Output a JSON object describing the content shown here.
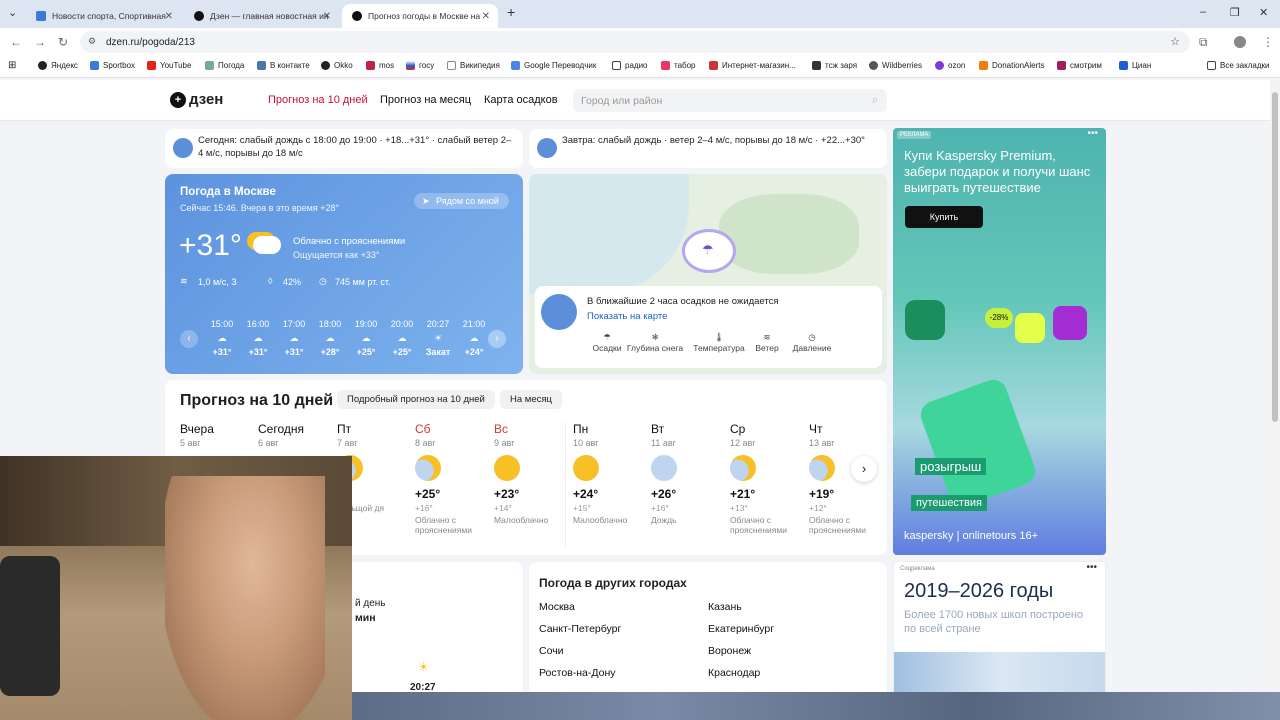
{
  "browser": {
    "tabs": [
      {
        "title": "Новости спорта, Спортивная"
      },
      {
        "title": "Дзен — главная новостная ин"
      },
      {
        "title": "Прогноз погоды в Москве на"
      }
    ],
    "new_tab": "+",
    "url": "dzen.ru/pogoda/213",
    "bookmarks": [
      "Яндекс",
      "Sportbox",
      "YouTube",
      "Погода",
      "В контакте",
      "Okko",
      "mos",
      "госу",
      "Википедия",
      "Google Переводчик",
      "радио",
      "табор",
      "Интернет-магазин...",
      "тсж заря",
      "Wildberries",
      "ozon",
      "DonationAlerts",
      "смотрим",
      "Циан"
    ],
    "all_bookmarks": "Все закладки"
  },
  "site": {
    "logo": "дзен",
    "nav": [
      "Прогноз на 10 дней",
      "Прогноз на месяц",
      "Карта осадков"
    ],
    "search_placeholder": "Город или район"
  },
  "today_banner": "Сегодня: слабый дождь с 18:00 до 19:00 · +18...+31° · слабый ветер 2–4 м/с, порывы до 18 м/с",
  "tomorrow_banner": "Завтра: слабый дождь · ветер 2–4 м/с, порывы до 18 м/с · +22...+30°",
  "current": {
    "title": "Погода в Москве",
    "subtitle": "Сейчас 15:46. Вчера в это время +28°",
    "nearby": "Рядом со мной",
    "temp": "+31°",
    "condition": "Облачно с прояснениями",
    "feels": "Ощущается как +33°",
    "wind": "1,0 м/с, З",
    "humidity": "42%",
    "pressure": "745 мм рт. ст.",
    "hours": [
      {
        "time": "15:00",
        "t": "+31°"
      },
      {
        "time": "16:00",
        "t": "+31°"
      },
      {
        "time": "17:00",
        "t": "+31°"
      },
      {
        "time": "18:00",
        "t": "+28°"
      },
      {
        "time": "19:00",
        "t": "+25°"
      },
      {
        "time": "20:00",
        "t": "+25°"
      },
      {
        "time": "20:27",
        "t": "Закат"
      },
      {
        "time": "21:00",
        "t": "+24°"
      }
    ]
  },
  "map": {
    "no_precip": "В ближайшие 2 часа осадков не ожидается",
    "show_map": "Показать на карте",
    "layers": [
      "Осадки",
      "Глубина снега",
      "Температура",
      "Ветер",
      "Давление"
    ]
  },
  "forecast": {
    "title": "Прогноз на 10 дней",
    "detail_btn": "Подробный прогноз на 10 дней",
    "month_btn": "На месяц",
    "days": [
      {
        "name": "Вчера",
        "date": "5 авг",
        "hi": "",
        "lo": "",
        "desc": "",
        "weekend": false
      },
      {
        "name": "Сегодня",
        "date": "6 авг",
        "hi": "",
        "lo": "",
        "desc": "",
        "weekend": false
      },
      {
        "name": "Пт",
        "date": "7 авг",
        "hi": "0°",
        "lo": "",
        "desc": "больщой дя",
        "weekend": false
      },
      {
        "name": "Сб",
        "date": "8 авг",
        "hi": "+25°",
        "lo": "+16°",
        "desc": "Облачно с прояснениями",
        "weekend": true
      },
      {
        "name": "Вс",
        "date": "9 авг",
        "hi": "+23°",
        "lo": "+14°",
        "desc": "Малооблачно",
        "weekend": true
      },
      {
        "name": "Пн",
        "date": "10 авг",
        "hi": "+24°",
        "lo": "+15°",
        "desc": "Малооблачно",
        "weekend": false
      },
      {
        "name": "Вт",
        "date": "11 авг",
        "hi": "+26°",
        "lo": "+16°",
        "desc": "Дождь",
        "weekend": false
      },
      {
        "name": "Ср",
        "date": "12 авг",
        "hi": "+21°",
        "lo": "+13°",
        "desc": "Облачно с прояснениями",
        "weekend": false
      },
      {
        "name": "Чт",
        "date": "13 авг",
        "hi": "+19°",
        "lo": "+12°",
        "desc": "Облачно с прояснениями",
        "weekend": false
      }
    ]
  },
  "sun": {
    "daylength": "й день",
    "minutes": "мин",
    "sunset": "20:27"
  },
  "cities": {
    "title": "Погода в других городах",
    "left": [
      "Москва",
      "Санкт-Петербург",
      "Сочи",
      "Ростов-на-Дону"
    ],
    "right": [
      "Казань",
      "Екатеринбург",
      "Воронеж",
      "Краснодар"
    ]
  },
  "ad1": {
    "label": "РЕКЛАМА",
    "headline": "Купи Kaspersky Premium, забери подарок и получи шанс выиграть путешествие",
    "button": "Купить",
    "badge": "-28%",
    "raffle1": "розыгрыш",
    "raffle2": "путешествия",
    "brand": "kaspersky | onlinetours 16+"
  },
  "ad2": {
    "label": "Соцреклама",
    "headline": "2019–2026 годы",
    "text": "Более 1700 новых школ построено по всей стране"
  }
}
